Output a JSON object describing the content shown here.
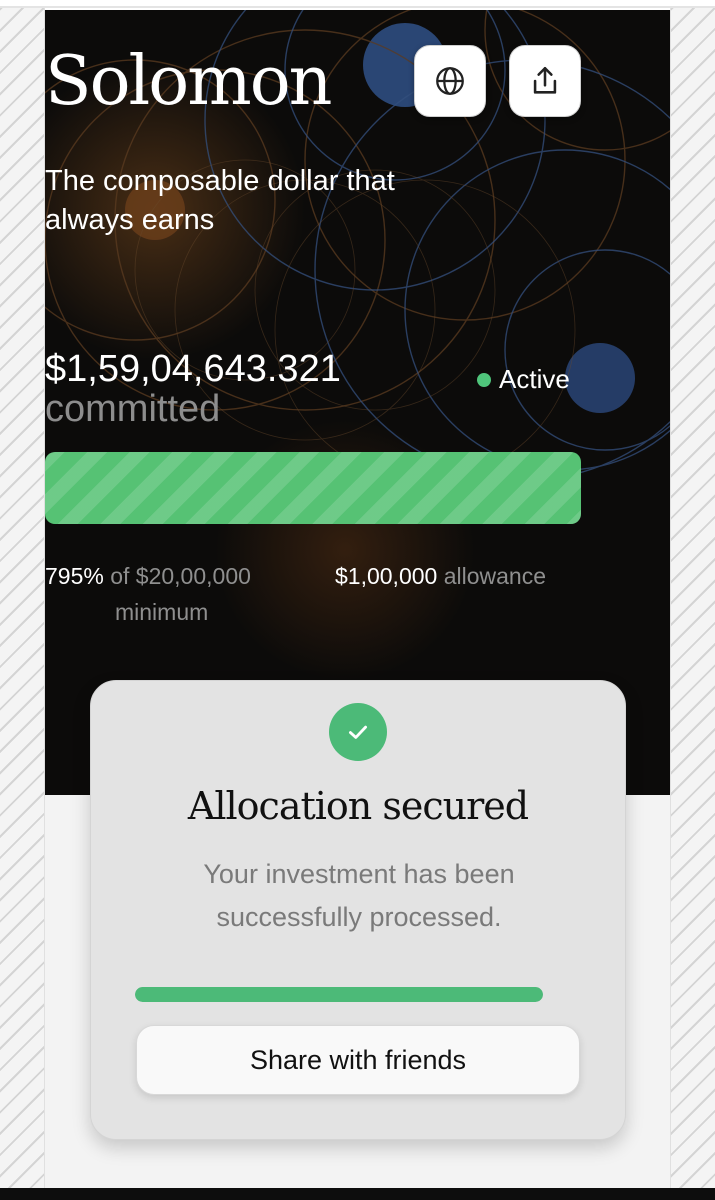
{
  "brand": {
    "name": "Solomon"
  },
  "toolbar": {
    "globe_icon": "globe-icon",
    "share_icon": "share-upload-icon"
  },
  "hero": {
    "tagline": "The composable dollar that always earns"
  },
  "stats": {
    "committed_amount": "$1,59,04,643.321",
    "committed_label": "committed",
    "status_label": "Active",
    "status_color": "#4fc57b",
    "progress_fraction": 1.0,
    "progress_color": "#56c274",
    "percent": "795%",
    "of_text": "of $20,00,000",
    "minimum_text": "minimum",
    "allowance_amount": "$1,00,000",
    "allowance_label": "allowance"
  },
  "card": {
    "check_icon": "check-icon",
    "title": "Allocation secured",
    "description": "Your investment has been successfully processed.",
    "progress_fraction": 1.0,
    "accent_color": "#4cba78",
    "share_button_label": "Share with friends"
  }
}
